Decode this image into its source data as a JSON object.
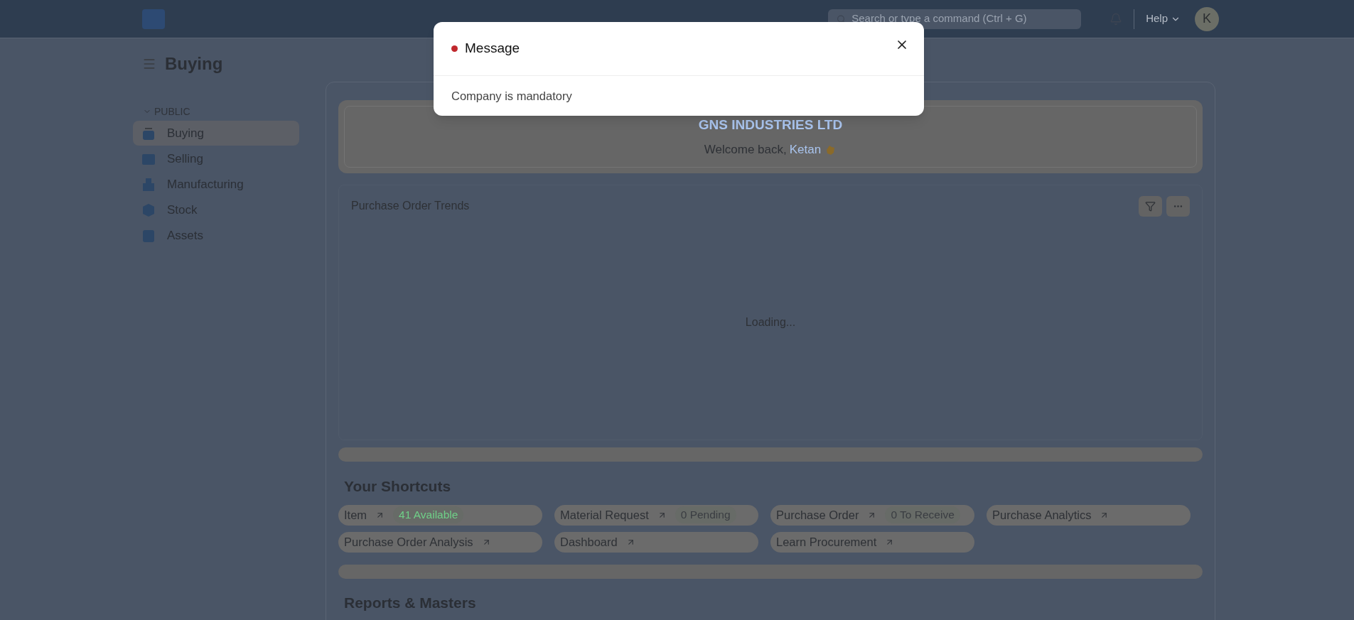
{
  "navbar": {
    "search": {
      "placeholder": "Search or type a command (Ctrl + G)"
    },
    "help": "Help",
    "avatar": "K"
  },
  "page": {
    "title": "Buying"
  },
  "sidebar": {
    "section": "PUBLIC",
    "expanded": true,
    "items": [
      {
        "label": "Buying",
        "selected": true,
        "kind": "bag"
      },
      {
        "label": "Selling",
        "selected": false,
        "kind": "card"
      },
      {
        "label": "Manufacturing",
        "selected": false,
        "kind": "building"
      },
      {
        "label": "Stock",
        "selected": false,
        "kind": "hexagon"
      },
      {
        "label": "Assets",
        "selected": false,
        "kind": "box"
      }
    ]
  },
  "banner": {
    "company": "GNS INDUSTRIES LTD",
    "greeting": "Welcome back,",
    "user": "Ketan"
  },
  "chart_card": {
    "title": "Purchase Order Trends",
    "status": "Loading..."
  },
  "shortcuts": {
    "heading": "Your Shortcuts",
    "items": [
      {
        "label": "Item",
        "count": "41 Available",
        "color": "#6fd088"
      },
      {
        "label": "Material Request",
        "count": "0 Pending",
        "color": "#3a3d42"
      },
      {
        "label": "Purchase Order",
        "count": "0 To Receive",
        "color": "#3a3d42"
      },
      {
        "label": "Purchase Analytics"
      },
      {
        "label": "Purchase Order Analysis"
      },
      {
        "label": "Dashboard"
      },
      {
        "label": "Learn Procurement"
      }
    ]
  },
  "reports": {
    "heading": "Reports & Masters"
  },
  "dialog": {
    "title": "Message",
    "color": "#c0282d",
    "message": "Company is mandatory"
  }
}
